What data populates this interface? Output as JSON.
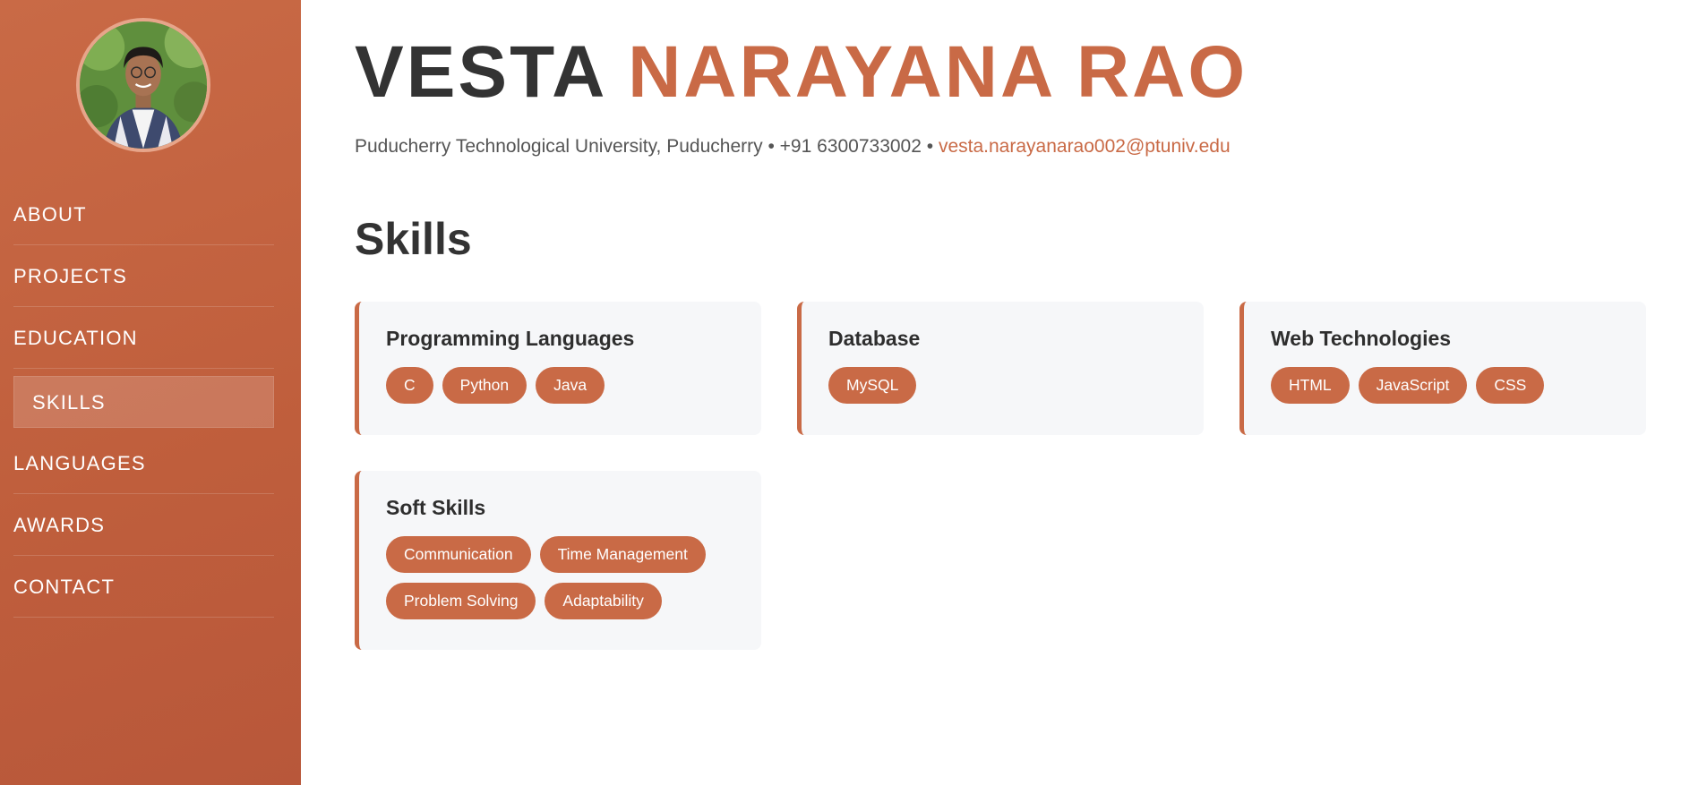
{
  "profile": {
    "first_name": "VESTA",
    "last_name": "NARAYANA RAO",
    "location": "Puducherry Technological University, Puducherry",
    "separator": "•",
    "phone": "+91 6300733002",
    "email": "vesta.narayanarao002@ptuniv.edu",
    "accent_color": "#c96a46"
  },
  "sidebar": {
    "items": [
      {
        "label": "ABOUT"
      },
      {
        "label": "PROJECTS"
      },
      {
        "label": "EDUCATION"
      },
      {
        "label": "SKILLS",
        "active": true
      },
      {
        "label": "LANGUAGES"
      },
      {
        "label": "AWARDS"
      },
      {
        "label": "CONTACT"
      }
    ]
  },
  "skills": {
    "title": "Skills",
    "groups": [
      {
        "title": "Programming Languages",
        "tags": [
          "C",
          "Python",
          "Java"
        ]
      },
      {
        "title": "Database",
        "tags": [
          "MySQL"
        ]
      },
      {
        "title": "Web Technologies",
        "tags": [
          "HTML",
          "JavaScript",
          "CSS"
        ]
      },
      {
        "title": "Soft Skills",
        "tags": [
          "Communication",
          "Time Management",
          "Problem Solving",
          "Adaptability"
        ]
      }
    ]
  }
}
